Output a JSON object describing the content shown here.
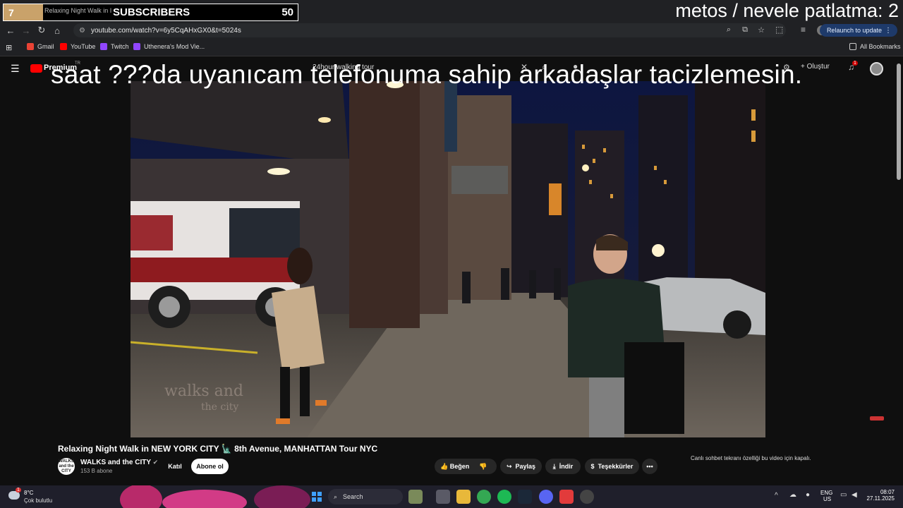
{
  "overlay": {
    "counter_num": "7",
    "tab_title": "Relaxing Night Walk in I",
    "subscribers_label": "SUBSCRIBERS",
    "subscribers_count": "50",
    "top_right_text": "metos / nevele patlatma: 2",
    "big_caption": "saat ???da uyanıcam telefonuma sahip arkadaşlar tacizlemesin."
  },
  "browser": {
    "url": "youtube.com/watch?v=6y5CqAHxGX0&t=5024s",
    "relaunch_label": "Relaunch to update",
    "bookmarks": [
      {
        "label": "Gmail",
        "color": "#ea4335"
      },
      {
        "label": "YouTube",
        "color": "#ff0000"
      },
      {
        "label": "Twitch",
        "color": "#9146ff"
      },
      {
        "label": "Uthenera's Mod Vie...",
        "color": "#9146ff"
      }
    ],
    "all_bookmarks": "All Bookmarks"
  },
  "youtube": {
    "logo": "Premium",
    "logo_sup": "TR",
    "search_query": "24hour walking tour",
    "create_label": "Oluştur",
    "notif_count": "1",
    "video_title": "Relaxing Night Walk in NEW YORK CITY 🗽 8th Avenue, MANHATTAN Tour NYC",
    "channel_name": "WALKS and the CITY",
    "channel_avatar": "WALKS and the CITY",
    "subscriber_count": "153 B abone",
    "join_label": "Katıl",
    "subscribe_label": "Abone ol",
    "like_label": "Beğen",
    "share_label": "Paylaş",
    "download_label": "İndir",
    "thanks_label": "Teşekkürler",
    "chat_disabled": "Canlı sohbet tekranı özelliği bu video için kapalı.",
    "watermark_line1": "walks and",
    "watermark_line2": "the city"
  },
  "taskbar": {
    "weather_temp": "8°C",
    "weather_desc": "Çok bulutlu",
    "weather_badge": "1",
    "search_label": "Search",
    "lang": "ENG",
    "lang_sub": "US",
    "time": "08:07",
    "date": "27.11.2025"
  }
}
